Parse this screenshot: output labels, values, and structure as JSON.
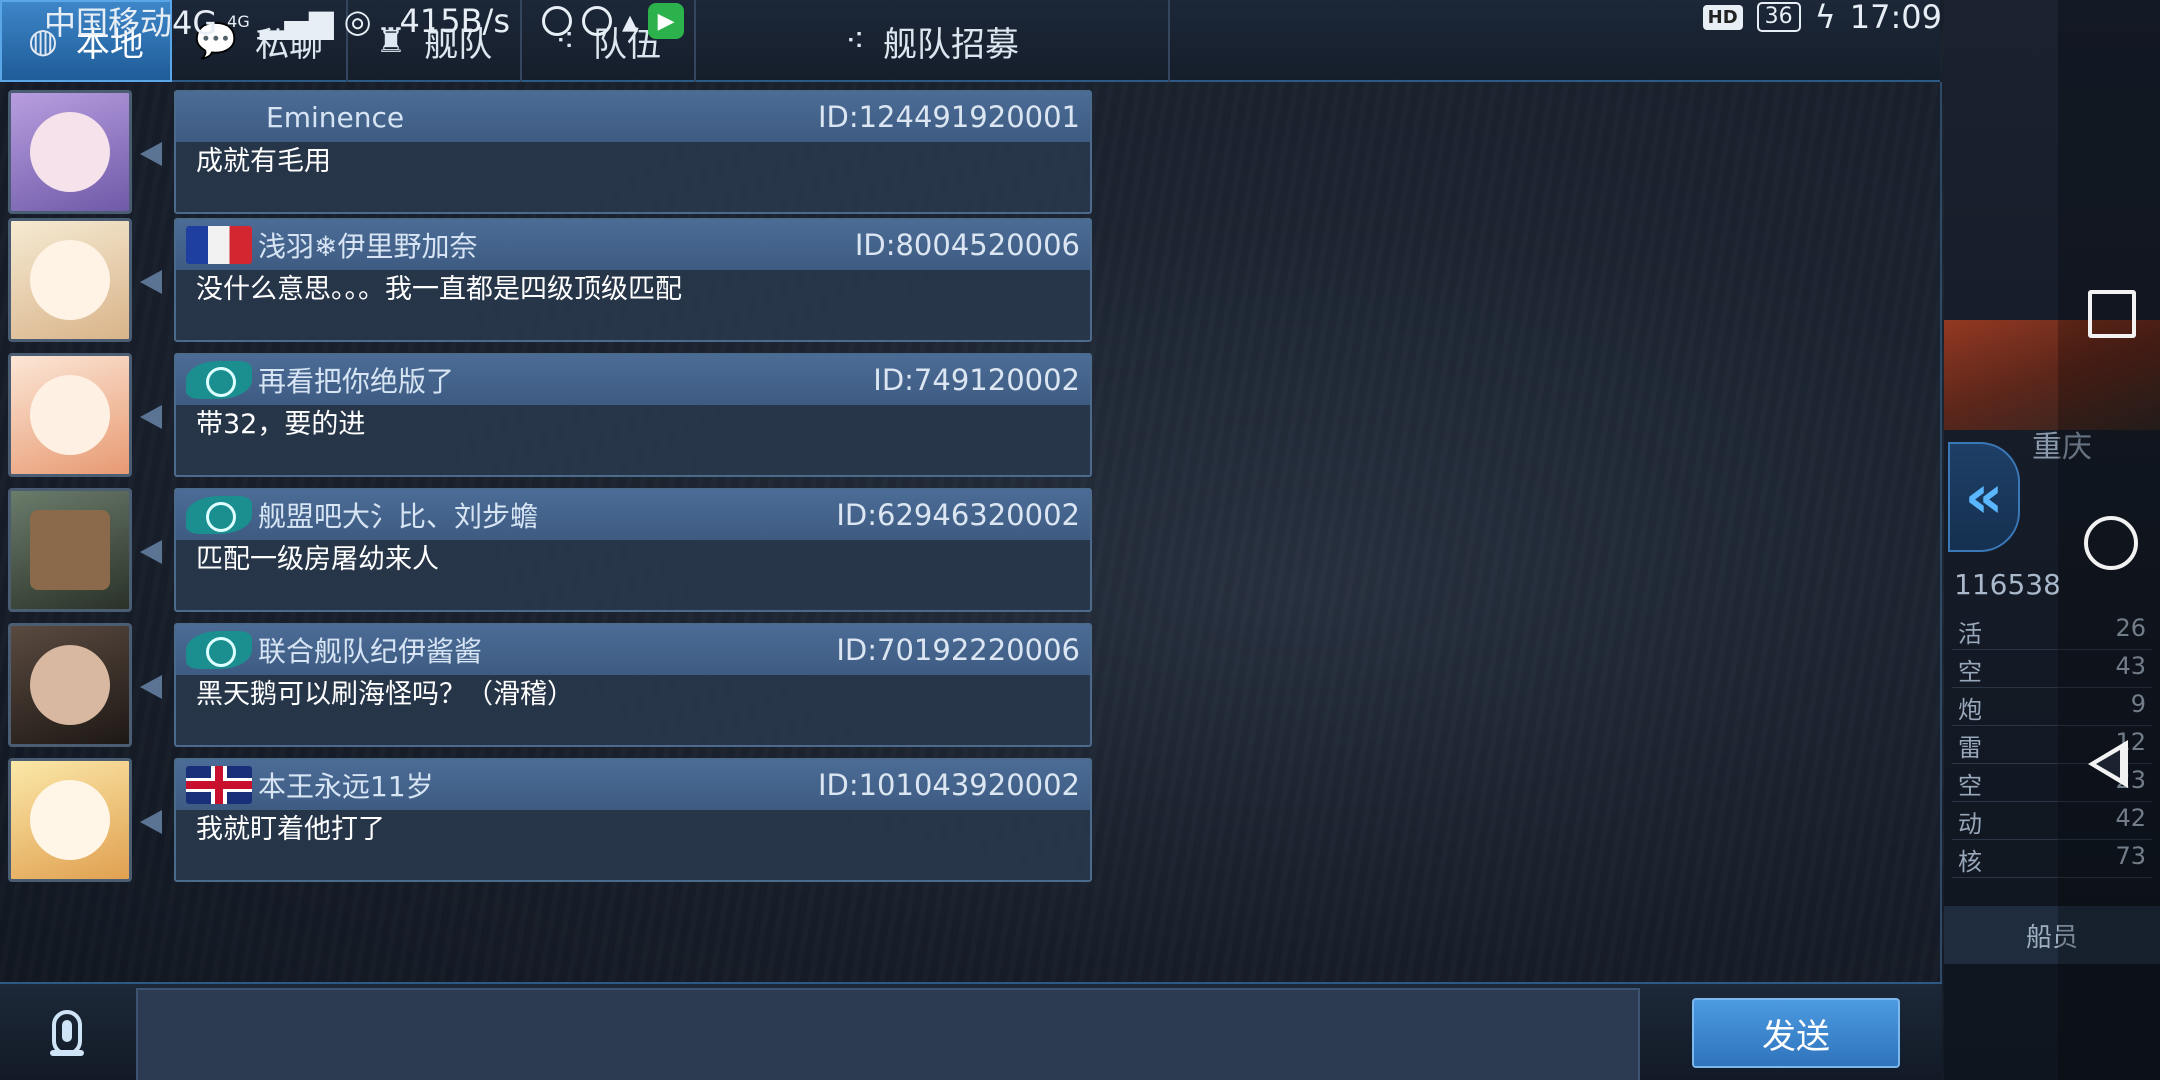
{
  "status_bar": {
    "carrier": "中国移动4G",
    "signal": "4G",
    "net_speed": "415B/s",
    "hd": "HD",
    "battery": "36",
    "time": "17:09"
  },
  "tabs": [
    {
      "label": "本地",
      "icon": "globe-icon",
      "active": true
    },
    {
      "label": "私聊",
      "icon": "chat-bubbles-icon",
      "active": false
    },
    {
      "label": "舰队",
      "icon": "fleet-helmet-icon",
      "active": false
    },
    {
      "label": "队伍",
      "icon": "team-dots-icon",
      "active": false
    },
    {
      "label": "舰队招募",
      "icon": "team-dots-icon",
      "active": false
    }
  ],
  "messages": [
    {
      "name": "Eminence",
      "id": "ID:124491920001",
      "text": "成就有毛用",
      "flag": "none",
      "avatar_color": "#c8b4e8"
    },
    {
      "name": "浅羽❄伊里野加奈",
      "id": "ID:8004520006",
      "text": "没什么意思。。。我一直都是四级顶级匹配",
      "flag": "fr",
      "avatar_color": "#f0e0c0"
    },
    {
      "name": "再看把你绝版了",
      "id": "ID:749120002",
      "text": "带32，要的进",
      "flag": "un",
      "avatar_color": "#f4c6a0"
    },
    {
      "name": "舰盟吧大氵比、刘步蟾",
      "id": "ID:62946320002",
      "text": "匹配一级房屠幼来人",
      "flag": "un",
      "avatar_color": "#5a6a5a"
    },
    {
      "name": "联合舰队纪伊酱酱",
      "id": "ID:70192220006",
      "text": "黑天鹅可以刷海怪吗？（滑稽）",
      "flag": "un",
      "avatar_color": "#4a3a34"
    },
    {
      "name": "本王永远11岁",
      "id": "ID:101043920002",
      "text": "我就盯着他打了",
      "flag": "gb",
      "avatar_color": "#f2dc8a"
    }
  ],
  "input": {
    "value": "",
    "placeholder": ""
  },
  "send_label": "发送",
  "side": {
    "city": "重庆",
    "number": "116538",
    "stats": [
      {
        "k": "活",
        "v": "26"
      },
      {
        "k": "空",
        "v": "43"
      },
      {
        "k": "炮",
        "v": "9"
      },
      {
        "k": "雷",
        "v": "12"
      },
      {
        "k": "空",
        "v": "23"
      },
      {
        "k": "动",
        "v": "42"
      },
      {
        "k": "核",
        "v": "73"
      }
    ],
    "crew_label": "船员"
  },
  "colors": {
    "accent": "#3d86c8",
    "bubble_header": "#4b6c96",
    "bubble_body": "#28374b",
    "send_button": "#3a86cf"
  }
}
